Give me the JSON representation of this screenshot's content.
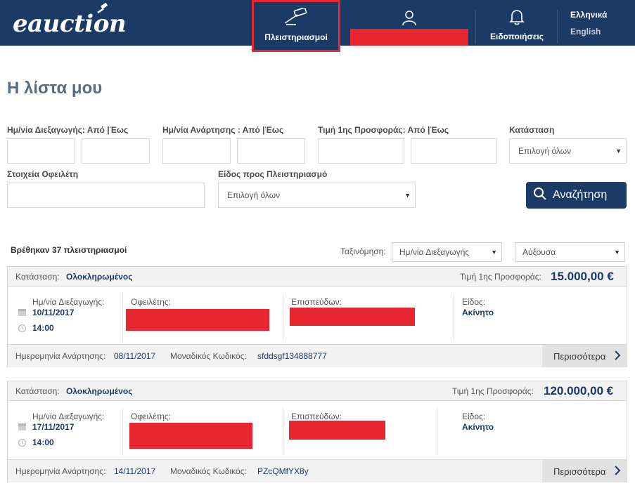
{
  "header": {
    "logo_text": "eauction",
    "nav_auctions": "Πλειστηριασμοί",
    "nav_notifications": "Ειδοποιήσεις",
    "lang_el": "Ελληνικά",
    "lang_en": "English",
    "icons": {
      "auctions": "gavel-icon",
      "user": "user-icon",
      "notifications": "bell-icon"
    },
    "colors": {
      "bar": "#1c3a66",
      "highlight": "#e8262f"
    }
  },
  "page": {
    "title": "Η λίστα μου"
  },
  "filters": {
    "date_conduct_label": "Ημ/νία Διεξαγωγής: Από |Έως",
    "date_posting_label": "Ημ/νία Ανάρτησης : Από |Έως",
    "first_offer_label": "Τιμή 1ης Προσφοράς: Από |Έως",
    "status_label": "Κατάσταση",
    "status_value": "Επιλογή όλων",
    "debtor_label": "Στοιχεία Οφειλέτη",
    "type_label": "Είδος προς Πλειστηριασμό",
    "type_value": "Επιλογή όλων",
    "search_button": "Αναζήτηση"
  },
  "results": {
    "found_text": "Βρέθηκαν 37 πλειστηριασμοί",
    "sort_label": "Ταξινόμηση:",
    "sort_field": "Ημ/νία Διεξαγωγής",
    "sort_order": "Αύξουσα"
  },
  "labels": {
    "status": "Κατάσταση:",
    "first_offer": "Τιμή 1ης Προσφοράς:",
    "date_conduct": "Ημ/νία Διεξαγωγής:",
    "debtor": "Οφειλέτης:",
    "creditor": "Επισπεύδων:",
    "type": "Είδος:",
    "posting_date": "Ημερομηνία Ανάρτησης:",
    "unique_code": "Μοναδικός Κωδικός:",
    "more": "Περισσότερα"
  },
  "auctions": [
    {
      "status": "Ολοκληρωμένος",
      "price": "15.000,00 €",
      "date": "10/11/2017",
      "time": "14:00",
      "type": "Ακίνητο",
      "posting_date": "08/11/2017",
      "code": "sfddsgf134888777"
    },
    {
      "status": "Ολοκληρωμένος",
      "price": "120.000,00 €",
      "date": "17/11/2017",
      "time": "14:00",
      "type": "Ακίνητο",
      "posting_date": "14/11/2017",
      "code": "PZcQMfYX8y"
    }
  ]
}
